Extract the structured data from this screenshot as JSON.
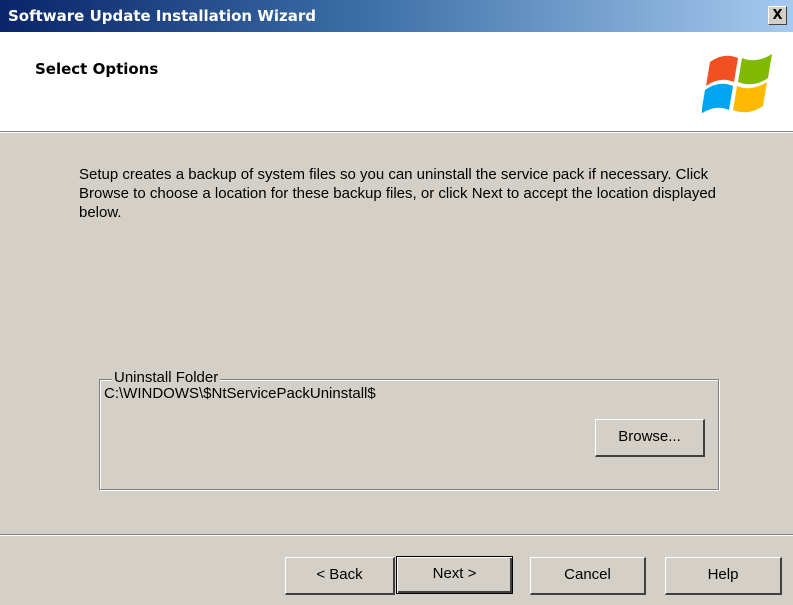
{
  "window": {
    "title": "Software Update Installation Wizard",
    "close_label": "X"
  },
  "header": {
    "title": "Select Options"
  },
  "main": {
    "description": "Setup creates a backup of system files so you can uninstall the service pack if necessary.  Click Browse to choose a location for these backup files, or click Next to accept the location displayed below.",
    "uninstall_group": {
      "label": "Uninstall Folder",
      "path": "C:\\WINDOWS\\$NtServicePackUninstall$",
      "browse_label": "Browse..."
    }
  },
  "footer": {
    "back_label": "< Back",
    "next_label": "Next >",
    "cancel_label": "Cancel",
    "help_label": "Help"
  },
  "colors": {
    "dialog_bg": "#d4d0c8",
    "title_gradient_start": "#0a246a",
    "title_gradient_end": "#a6caf0",
    "header_bg": "#ffffff"
  },
  "icons": {
    "logo": "windows-flag-logo",
    "close": "close-icon"
  }
}
